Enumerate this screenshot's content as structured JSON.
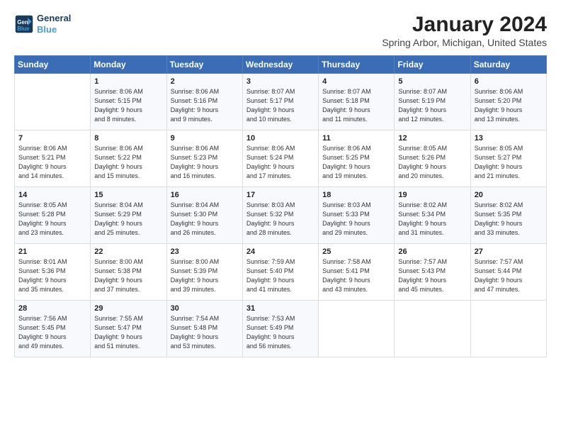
{
  "header": {
    "logo_line1": "General",
    "logo_line2": "Blue",
    "title": "January 2024",
    "subtitle": "Spring Arbor, Michigan, United States"
  },
  "days_of_week": [
    "Sunday",
    "Monday",
    "Tuesday",
    "Wednesday",
    "Thursday",
    "Friday",
    "Saturday"
  ],
  "weeks": [
    [
      {
        "num": "",
        "info": ""
      },
      {
        "num": "1",
        "info": "Sunrise: 8:06 AM\nSunset: 5:15 PM\nDaylight: 9 hours\nand 8 minutes."
      },
      {
        "num": "2",
        "info": "Sunrise: 8:06 AM\nSunset: 5:16 PM\nDaylight: 9 hours\nand 9 minutes."
      },
      {
        "num": "3",
        "info": "Sunrise: 8:07 AM\nSunset: 5:17 PM\nDaylight: 9 hours\nand 10 minutes."
      },
      {
        "num": "4",
        "info": "Sunrise: 8:07 AM\nSunset: 5:18 PM\nDaylight: 9 hours\nand 11 minutes."
      },
      {
        "num": "5",
        "info": "Sunrise: 8:07 AM\nSunset: 5:19 PM\nDaylight: 9 hours\nand 12 minutes."
      },
      {
        "num": "6",
        "info": "Sunrise: 8:06 AM\nSunset: 5:20 PM\nDaylight: 9 hours\nand 13 minutes."
      }
    ],
    [
      {
        "num": "7",
        "info": "Sunrise: 8:06 AM\nSunset: 5:21 PM\nDaylight: 9 hours\nand 14 minutes."
      },
      {
        "num": "8",
        "info": "Sunrise: 8:06 AM\nSunset: 5:22 PM\nDaylight: 9 hours\nand 15 minutes."
      },
      {
        "num": "9",
        "info": "Sunrise: 8:06 AM\nSunset: 5:23 PM\nDaylight: 9 hours\nand 16 minutes."
      },
      {
        "num": "10",
        "info": "Sunrise: 8:06 AM\nSunset: 5:24 PM\nDaylight: 9 hours\nand 17 minutes."
      },
      {
        "num": "11",
        "info": "Sunrise: 8:06 AM\nSunset: 5:25 PM\nDaylight: 9 hours\nand 19 minutes."
      },
      {
        "num": "12",
        "info": "Sunrise: 8:05 AM\nSunset: 5:26 PM\nDaylight: 9 hours\nand 20 minutes."
      },
      {
        "num": "13",
        "info": "Sunrise: 8:05 AM\nSunset: 5:27 PM\nDaylight: 9 hours\nand 21 minutes."
      }
    ],
    [
      {
        "num": "14",
        "info": "Sunrise: 8:05 AM\nSunset: 5:28 PM\nDaylight: 9 hours\nand 23 minutes."
      },
      {
        "num": "15",
        "info": "Sunrise: 8:04 AM\nSunset: 5:29 PM\nDaylight: 9 hours\nand 25 minutes."
      },
      {
        "num": "16",
        "info": "Sunrise: 8:04 AM\nSunset: 5:30 PM\nDaylight: 9 hours\nand 26 minutes."
      },
      {
        "num": "17",
        "info": "Sunrise: 8:03 AM\nSunset: 5:32 PM\nDaylight: 9 hours\nand 28 minutes."
      },
      {
        "num": "18",
        "info": "Sunrise: 8:03 AM\nSunset: 5:33 PM\nDaylight: 9 hours\nand 29 minutes."
      },
      {
        "num": "19",
        "info": "Sunrise: 8:02 AM\nSunset: 5:34 PM\nDaylight: 9 hours\nand 31 minutes."
      },
      {
        "num": "20",
        "info": "Sunrise: 8:02 AM\nSunset: 5:35 PM\nDaylight: 9 hours\nand 33 minutes."
      }
    ],
    [
      {
        "num": "21",
        "info": "Sunrise: 8:01 AM\nSunset: 5:36 PM\nDaylight: 9 hours\nand 35 minutes."
      },
      {
        "num": "22",
        "info": "Sunrise: 8:00 AM\nSunset: 5:38 PM\nDaylight: 9 hours\nand 37 minutes."
      },
      {
        "num": "23",
        "info": "Sunrise: 8:00 AM\nSunset: 5:39 PM\nDaylight: 9 hours\nand 39 minutes."
      },
      {
        "num": "24",
        "info": "Sunrise: 7:59 AM\nSunset: 5:40 PM\nDaylight: 9 hours\nand 41 minutes."
      },
      {
        "num": "25",
        "info": "Sunrise: 7:58 AM\nSunset: 5:41 PM\nDaylight: 9 hours\nand 43 minutes."
      },
      {
        "num": "26",
        "info": "Sunrise: 7:57 AM\nSunset: 5:43 PM\nDaylight: 9 hours\nand 45 minutes."
      },
      {
        "num": "27",
        "info": "Sunrise: 7:57 AM\nSunset: 5:44 PM\nDaylight: 9 hours\nand 47 minutes."
      }
    ],
    [
      {
        "num": "28",
        "info": "Sunrise: 7:56 AM\nSunset: 5:45 PM\nDaylight: 9 hours\nand 49 minutes."
      },
      {
        "num": "29",
        "info": "Sunrise: 7:55 AM\nSunset: 5:47 PM\nDaylight: 9 hours\nand 51 minutes."
      },
      {
        "num": "30",
        "info": "Sunrise: 7:54 AM\nSunset: 5:48 PM\nDaylight: 9 hours\nand 53 minutes."
      },
      {
        "num": "31",
        "info": "Sunrise: 7:53 AM\nSunset: 5:49 PM\nDaylight: 9 hours\nand 56 minutes."
      },
      {
        "num": "",
        "info": ""
      },
      {
        "num": "",
        "info": ""
      },
      {
        "num": "",
        "info": ""
      }
    ]
  ]
}
